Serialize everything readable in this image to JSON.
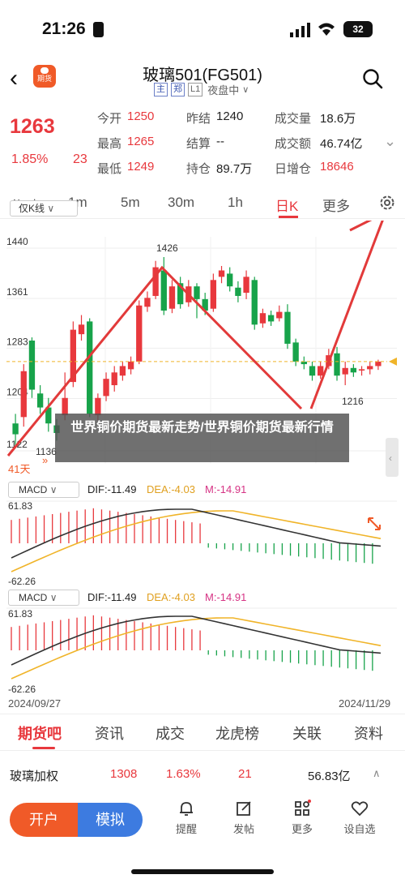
{
  "status_bar": {
    "time": "21:26",
    "battery": "32"
  },
  "header": {
    "title": "玻璃501(FG501)",
    "logo_text": "期货",
    "tags": [
      "主",
      "郑",
      "L1"
    ],
    "session": "夜盘中"
  },
  "quote": {
    "last_price": "1263",
    "change_pct": "1.85%",
    "change_abs": "23",
    "fields": [
      {
        "label": "今开",
        "value": "1250",
        "color": "red"
      },
      {
        "label": "昨结",
        "value": "1240",
        "color": "default"
      },
      {
        "label": "成交量",
        "value": "18.6万",
        "color": "default"
      },
      {
        "label": "最高",
        "value": "1265",
        "color": "red"
      },
      {
        "label": "结算",
        "value": "--",
        "color": "default"
      },
      {
        "label": "成交额",
        "value": "46.74亿",
        "color": "default"
      },
      {
        "label": "最低",
        "value": "1249",
        "color": "red"
      },
      {
        "label": "持仓",
        "value": "89.7万",
        "color": "default"
      },
      {
        "label": "日增仓",
        "value": "18646",
        "color": "red"
      }
    ]
  },
  "period_tabs": [
    "分时",
    "1m",
    "5m",
    "30m",
    "1h",
    "日K",
    "更多"
  ],
  "active_period": "日K",
  "kline": {
    "selector": "仅K线",
    "y_labels": [
      "1440",
      "1361",
      "1283",
      "1204",
      "1122"
    ],
    "high_label": "1426",
    "low_label": "1136",
    "right_low_label": "1216",
    "days_label": "41天",
    "candles": [
      {
        "o": 1165,
        "c": 1148,
        "h": 1180,
        "l": 1130
      },
      {
        "o": 1175,
        "c": 1247,
        "h": 1258,
        "l": 1160
      },
      {
        "o": 1295,
        "c": 1218,
        "h": 1300,
        "l": 1205
      },
      {
        "o": 1212,
        "c": 1190,
        "h": 1225,
        "l": 1180
      },
      {
        "o": 1190,
        "c": 1165,
        "h": 1205,
        "l": 1152
      },
      {
        "o": 1162,
        "c": 1150,
        "h": 1172,
        "l": 1138
      },
      {
        "o": 1178,
        "c": 1205,
        "h": 1245,
        "l": 1170
      },
      {
        "o": 1230,
        "c": 1312,
        "h": 1325,
        "l": 1222
      },
      {
        "o": 1305,
        "c": 1320,
        "h": 1335,
        "l": 1295
      },
      {
        "o": 1325,
        "c": 1180,
        "h": 1330,
        "l": 1175
      },
      {
        "o": 1178,
        "c": 1205,
        "h": 1212,
        "l": 1170
      },
      {
        "o": 1208,
        "c": 1235,
        "h": 1245,
        "l": 1200
      },
      {
        "o": 1225,
        "c": 1245,
        "h": 1255,
        "l": 1215
      },
      {
        "o": 1240,
        "c": 1255,
        "h": 1262,
        "l": 1232
      },
      {
        "o": 1250,
        "c": 1262,
        "h": 1270,
        "l": 1242
      },
      {
        "o": 1262,
        "c": 1350,
        "h": 1358,
        "l": 1258
      },
      {
        "o": 1348,
        "c": 1362,
        "h": 1372,
        "l": 1340
      },
      {
        "o": 1365,
        "c": 1410,
        "h": 1420,
        "l": 1360
      },
      {
        "o": 1405,
        "c": 1342,
        "h": 1426,
        "l": 1335
      },
      {
        "o": 1345,
        "c": 1380,
        "h": 1390,
        "l": 1338
      },
      {
        "o": 1385,
        "c": 1352,
        "h": 1395,
        "l": 1345
      },
      {
        "o": 1355,
        "c": 1380,
        "h": 1390,
        "l": 1348
      },
      {
        "o": 1380,
        "c": 1360,
        "h": 1385,
        "l": 1330
      },
      {
        "o": 1360,
        "c": 1342,
        "h": 1370,
        "l": 1335
      },
      {
        "o": 1345,
        "c": 1390,
        "h": 1400,
        "l": 1340
      },
      {
        "o": 1395,
        "c": 1405,
        "h": 1412,
        "l": 1385
      },
      {
        "o": 1400,
        "c": 1380,
        "h": 1410,
        "l": 1372
      },
      {
        "o": 1378,
        "c": 1365,
        "h": 1388,
        "l": 1355
      },
      {
        "o": 1370,
        "c": 1395,
        "h": 1405,
        "l": 1360
      },
      {
        "o": 1390,
        "c": 1320,
        "h": 1395,
        "l": 1312
      },
      {
        "o": 1322,
        "c": 1338,
        "h": 1345,
        "l": 1315
      },
      {
        "o": 1335,
        "c": 1325,
        "h": 1342,
        "l": 1318
      },
      {
        "o": 1330,
        "c": 1340,
        "h": 1350,
        "l": 1325
      },
      {
        "o": 1340,
        "c": 1290,
        "h": 1352,
        "l": 1282
      },
      {
        "o": 1292,
        "c": 1262,
        "h": 1298,
        "l": 1255
      },
      {
        "o": 1262,
        "c": 1258,
        "h": 1270,
        "l": 1250
      },
      {
        "o": 1255,
        "c": 1240,
        "h": 1262,
        "l": 1232
      },
      {
        "o": 1240,
        "c": 1255,
        "h": 1262,
        "l": 1235
      },
      {
        "o": 1255,
        "c": 1272,
        "h": 1282,
        "l": 1250
      },
      {
        "o": 1275,
        "c": 1240,
        "h": 1285,
        "l": 1232
      },
      {
        "o": 1242,
        "c": 1252,
        "h": 1262,
        "l": 1225
      },
      {
        "o": 1252,
        "c": 1245,
        "h": 1258,
        "l": 1238
      },
      {
        "o": 1248,
        "c": 1250,
        "h": 1255,
        "l": 1240
      },
      {
        "o": 1250,
        "c": 1255,
        "h": 1262,
        "l": 1242
      },
      {
        "o": 1255,
        "c": 1262,
        "h": 1265,
        "l": 1249
      }
    ]
  },
  "macd": {
    "selector": "MACD",
    "dif": "DIF:-11.49",
    "dea": "DEA:-4.03",
    "m": "M:-14.91",
    "top_label": "61.83",
    "bottom_label": "-62.26",
    "colors": {
      "dif": "#333333",
      "dea": "#f0b429",
      "m": "#d63384"
    }
  },
  "dates": {
    "start": "2024/09/27",
    "end": "2024/11/29"
  },
  "overlay": "世界铜价期货最新走势/世界铜价期货最新行情",
  "content_tabs": [
    "期货吧",
    "资讯",
    "成交",
    "龙虎榜",
    "关联",
    "资料"
  ],
  "active_content_tab": "期货吧",
  "weighted": {
    "name": "玻璃加权",
    "price": "1308",
    "pct": "1.63%",
    "abs": "21",
    "amount": "56.83亿"
  },
  "bottom_bar": {
    "open_account": "开户",
    "simulate": "模拟",
    "nav": [
      "提醒",
      "发帖",
      "更多",
      "设自选"
    ]
  },
  "colors": {
    "up": "#e8383d",
    "down": "#17a34a",
    "accent": "#f05a28",
    "blue": "#3d7be0"
  }
}
